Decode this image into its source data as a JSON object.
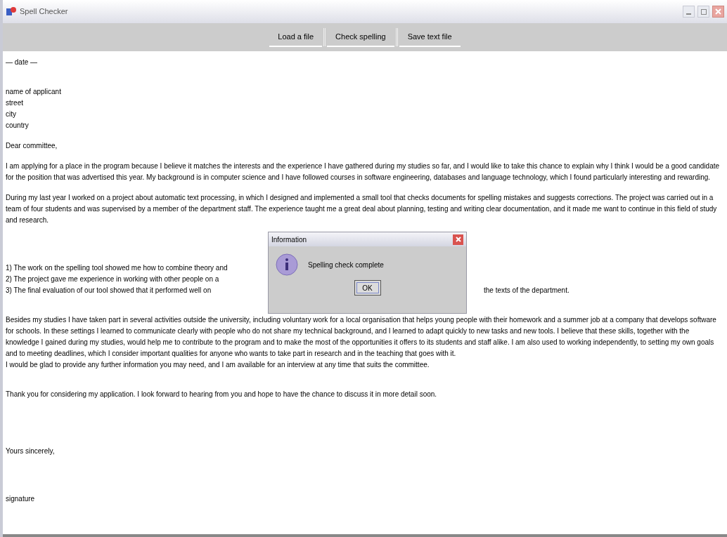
{
  "window": {
    "title": "Spell Checker"
  },
  "toolbar": [
    "Load a file",
    "Check spelling",
    "Save text file"
  ],
  "document": [
    {
      "kind": "line",
      "text": "— date —"
    },
    {
      "kind": "gap"
    },
    {
      "kind": "gap"
    },
    {
      "kind": "line",
      "text": "name of applicant"
    },
    {
      "kind": "line",
      "text": "street"
    },
    {
      "kind": "line",
      "text": "city"
    },
    {
      "kind": "line",
      "text": "country"
    },
    {
      "kind": "gap"
    },
    {
      "kind": "line",
      "text": "Dear committee,"
    },
    {
      "kind": "gap"
    },
    {
      "kind": "para",
      "text": "I am applying for a place in the program because I believe it matches the interests and the experience I have gathered during my studies so far, and I would like to take this chance to explain why I think I would be a good candidate for the position that was advertised this year. My background is in computer science and I have followed courses in software engineering, databases and language technology, which I found particularly interesting and rewarding."
    },
    {
      "kind": "gap"
    },
    {
      "kind": "para",
      "text": "During my last year I worked on a project about automatic text processing, in which I designed and implemented a small tool that checks documents for spelling mistakes and suggests corrections. The project was carried out in a team of four students and was supervised by a member of the department staff. The experience taught me a great deal about planning, testing and writing clear documentation, and it made me want to continue in this field of study and research."
    },
    {
      "kind": "gap"
    },
    {
      "kind": "gap"
    },
    {
      "kind": "gap"
    },
    {
      "kind": "gap"
    },
    {
      "kind": "split",
      "left": "1) The work on the spelling tool showed me how to combine theory and"
    },
    {
      "kind": "split",
      "left": "2) The project gave me experience in working with other people on a"
    },
    {
      "kind": "split",
      "left": "3) The final evaluation of our tool showed that it performed well on",
      "right": "the texts of the department."
    },
    {
      "kind": "gap"
    },
    {
      "kind": "gap"
    },
    {
      "kind": "para",
      "text": "Besides my studies I have taken part in several activities outside the university, including voluntary work for a local organisation that helps young people with their homework and a summer job at a company that develops software for schools. In these settings I learned to communicate clearly with people who do not share my technical background, and I learned to adapt quickly to new tasks and new tools. I believe that these skills, together with the knowledge I gained during my studies, would help me to contribute to the program and to make the most of the opportunities it offers to its students and staff alike. I am also used to working independently, to setting my own goals and to meeting deadlines, which I consider important qualities for anyone who wants to take part in research and in the teaching that goes with it."
    },
    {
      "kind": "line",
      "text": "I would be glad to provide any further information you may need, and I am available for an interview at any time that suits the committee."
    },
    {
      "kind": "gap"
    },
    {
      "kind": "gap"
    },
    {
      "kind": "line",
      "text": "Thank you for considering my application. I look forward to hearing from you and hope to have the chance to discuss it in more detail soon."
    },
    {
      "kind": "gap"
    },
    {
      "kind": "gap"
    },
    {
      "kind": "gap"
    },
    {
      "kind": "gap"
    },
    {
      "kind": "gap"
    },
    {
      "kind": "line",
      "text": "Yours sincerely,"
    },
    {
      "kind": "gap"
    },
    {
      "kind": "gap"
    },
    {
      "kind": "gap"
    },
    {
      "kind": "gap"
    },
    {
      "kind": "line",
      "text": "signature"
    }
  ],
  "dialog": {
    "title": "Information",
    "message": "Spelling check complete",
    "button": "OK"
  }
}
